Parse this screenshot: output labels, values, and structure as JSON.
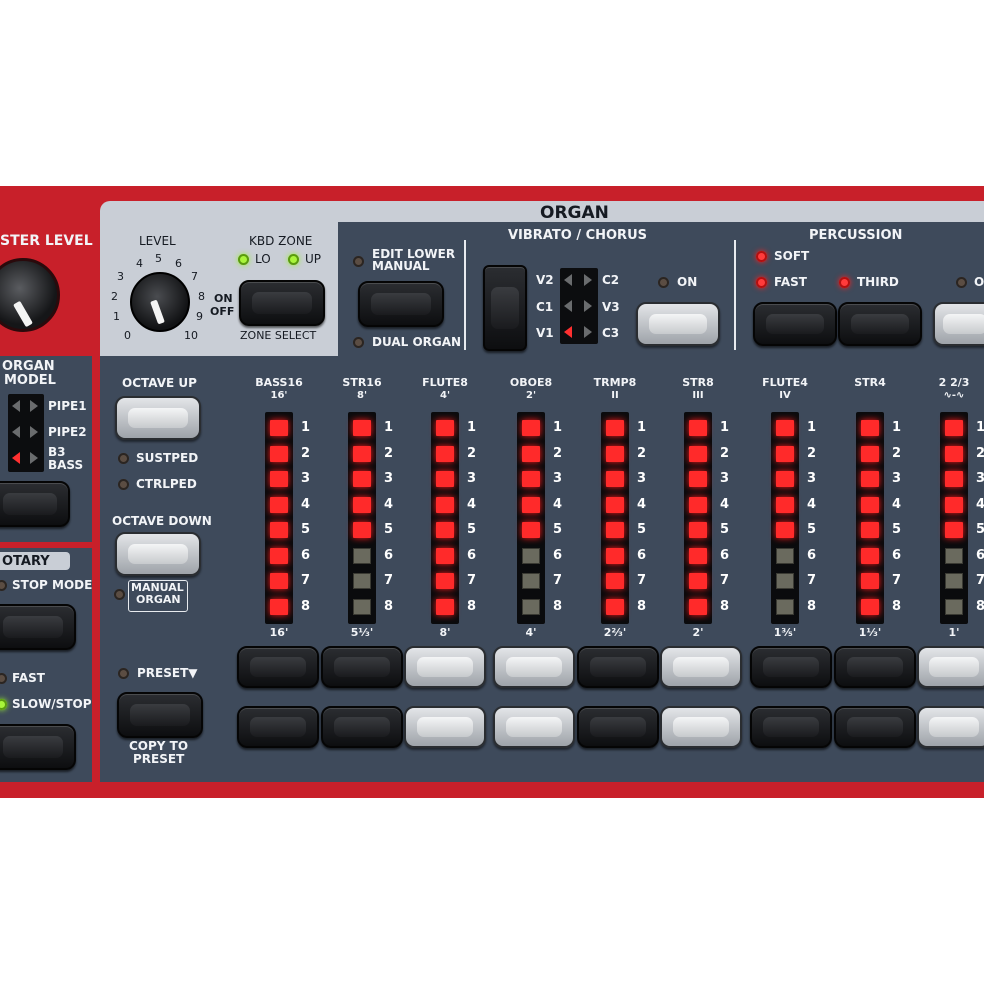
{
  "master": {
    "level_label": "STER LEVEL"
  },
  "organ": {
    "title": "ORGAN",
    "level": {
      "label": "LEVEL",
      "scale": [
        "0",
        "1",
        "2",
        "3",
        "4",
        "5",
        "6",
        "7",
        "8",
        "9",
        "10"
      ],
      "on_off_top": "ON",
      "on_off_bottom": "OFF"
    },
    "kbd_zone": {
      "label": "KBD ZONE",
      "lo": "LO",
      "up": "UP",
      "zone_select": "ZONE SELECT"
    },
    "edit_lower_manual": "EDIT LOWER MANUAL",
    "dual_organ": "DUAL ORGAN",
    "vibrato_chorus": {
      "title": "VIBRATO / CHORUS",
      "v2": "V2",
      "c2": "C2",
      "c1": "C1",
      "v3": "V3",
      "v1": "V1",
      "c3": "C3",
      "on": "ON"
    },
    "percussion": {
      "title": "PERCUSSION",
      "soft": "SOFT",
      "fast": "FAST",
      "third": "THIRD",
      "o": "O"
    }
  },
  "organ_model": {
    "title_1": "ORGAN",
    "title_2": "MODEL",
    "pipe1": "PIPE1",
    "pipe2": "PIPE2",
    "b3": "B3",
    "bass": "BASS"
  },
  "octave": {
    "up": "OCTAVE UP",
    "down": "OCTAVE DOWN",
    "sustped": "SUSTPED",
    "ctrlped": "CTRLPED",
    "manual_1": "MANUAL",
    "manual_2": "ORGAN"
  },
  "rotary": {
    "title": "OTARY",
    "stop_mode": "STOP MODE",
    "fast": "FAST",
    "slow_stop": "SLOW/STOP"
  },
  "preset": {
    "label": "PRESET▼",
    "copy_1": "COPY TO",
    "copy_2": "PRESET"
  },
  "drawbar_numbers": [
    "1",
    "2",
    "3",
    "4",
    "5",
    "6",
    "7",
    "8"
  ],
  "drawbars": [
    {
      "name": "BASS16",
      "sub": "16'",
      "foot": "16'",
      "level": 8
    },
    {
      "name": "STR16",
      "sub": "8'",
      "foot": "5⅓'",
      "level": 5
    },
    {
      "name": "FLUTE8",
      "sub": "4'",
      "foot": "8'",
      "level": 8
    },
    {
      "name": "OBOE8",
      "sub": "2'",
      "foot": "4'",
      "level": 5
    },
    {
      "name": "TRMP8",
      "sub": "II",
      "foot": "2⅔'",
      "level": 8
    },
    {
      "name": "STR8",
      "sub": "III",
      "foot": "2'",
      "level": 8
    },
    {
      "name": "FLUTE4",
      "sub": "IV",
      "foot": "1⅗'",
      "level": 5
    },
    {
      "name": "STR4",
      "sub": "",
      "foot": "1⅓'",
      "level": 8
    },
    {
      "name": "2 2/3",
      "sub": "∿-∿",
      "foot": "1'",
      "level": 5
    }
  ],
  "colors": {
    "panel_red": "#c8202a",
    "panel_dark": "#3e4a5b",
    "panel_light": "#c9ced6",
    "led_red": "#ff2a2a",
    "led_green": "#a9f53a"
  }
}
